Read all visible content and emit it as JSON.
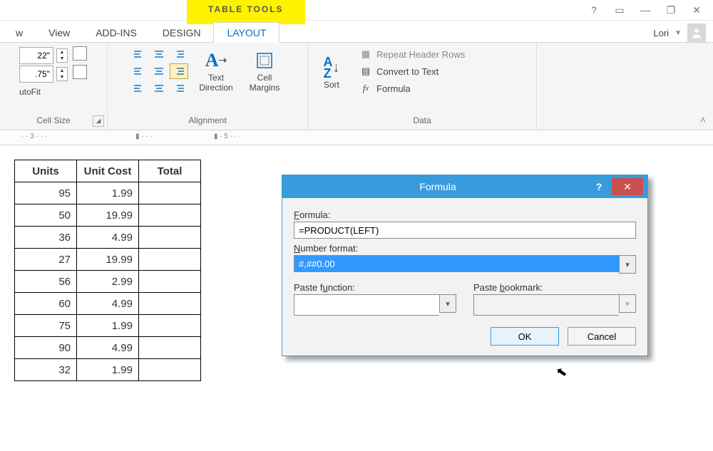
{
  "titlebar": {
    "context_tab": "TABLE TOOLS"
  },
  "tabs": {
    "t0": "w",
    "t1": "View",
    "t2": "ADD-INS",
    "t3": "DESIGN",
    "t4": "LAYOUT"
  },
  "user": {
    "name": "Lori"
  },
  "ribbon": {
    "cellsize": {
      "label": "Cell Size",
      "height": "22\"",
      "width": ".75\"",
      "autofit": "utoFit"
    },
    "alignment": {
      "label": "Alignment",
      "textdir": "Text Direction",
      "margins": "Cell Margins"
    },
    "sort": "Sort",
    "data": {
      "label": "Data",
      "repeat": "Repeat Header Rows",
      "convert": "Convert to Text",
      "formula": "Formula"
    }
  },
  "table": {
    "headers": [
      "Units",
      "Unit Cost",
      "Total"
    ],
    "rows": [
      [
        "95",
        "1.99",
        ""
      ],
      [
        "50",
        "19.99",
        ""
      ],
      [
        "36",
        "4.99",
        ""
      ],
      [
        "27",
        "19.99",
        ""
      ],
      [
        "56",
        "2.99",
        ""
      ],
      [
        "60",
        "4.99",
        ""
      ],
      [
        "75",
        "1.99",
        ""
      ],
      [
        "90",
        "4.99",
        ""
      ],
      [
        "32",
        "1.99",
        ""
      ]
    ]
  },
  "dialog": {
    "title": "Formula",
    "formula_label": "Formula:",
    "formula_value": "=PRODUCT(LEFT)",
    "numfmt_label": "Number format:",
    "numfmt_value": "#,##0.00",
    "pastefn_label": "Paste function:",
    "pastebm_label": "Paste bookmark:",
    "ok": "OK",
    "cancel": "Cancel"
  }
}
